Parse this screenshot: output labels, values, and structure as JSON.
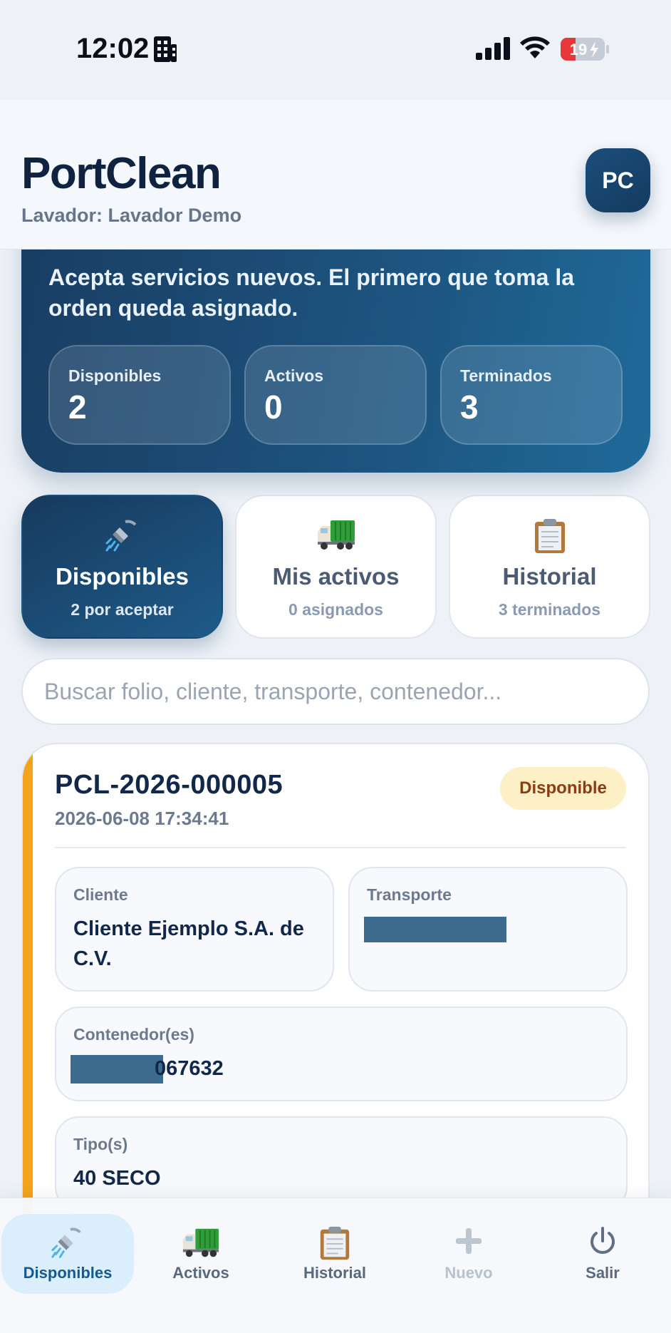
{
  "status_bar": {
    "time": "12:02",
    "battery": "19"
  },
  "header": {
    "app_title": "PortClean",
    "subtitle": "Lavador: Lavador Demo",
    "avatar_initials": "PC"
  },
  "hero": {
    "description": "Acepta servicios nuevos. El primero que toma la orden queda asignado.",
    "stats": [
      {
        "label": "Disponibles",
        "value": "2"
      },
      {
        "label": "Activos",
        "value": "0"
      },
      {
        "label": "Terminados",
        "value": "3"
      }
    ]
  },
  "tabs": [
    {
      "title": "Disponibles",
      "subtitle": "2 por aceptar",
      "icon": "shower-icon",
      "active": true
    },
    {
      "title": "Mis activos",
      "subtitle": "0 asignados",
      "icon": "truck-icon",
      "active": false
    },
    {
      "title": "Historial",
      "subtitle": "3 terminados",
      "icon": "clipboard-icon",
      "active": false
    }
  ],
  "search": {
    "placeholder": "Buscar folio, cliente, transporte, contenedor...",
    "value": ""
  },
  "order": {
    "folio": "PCL-2026-000005",
    "date": "2026-06-08 17:34:41",
    "status": "Disponible",
    "accent_color": "#f5a31a",
    "fields": {
      "cliente_label": "Cliente",
      "cliente_value": "Cliente Ejemplo S.A. de C.V.",
      "transporte_label": "Transporte",
      "contenedor_label": "Contenedor(es)",
      "contenedor_value_visible": "067632",
      "tipo_label": "Tipo(s)",
      "tipo_value": "40 SECO"
    }
  },
  "bottom_nav": [
    {
      "label": "Disponibles",
      "icon": "shower-icon",
      "active": true
    },
    {
      "label": "Activos",
      "icon": "truck-icon",
      "active": false
    },
    {
      "label": "Historial",
      "icon": "clipboard-icon",
      "active": false
    },
    {
      "label": "Nuevo",
      "icon": "plus-icon",
      "active": false,
      "disabled": true
    },
    {
      "label": "Salir",
      "icon": "power-icon",
      "active": false
    }
  ],
  "colors": {
    "primary": "#173a5e",
    "accent": "#f5a31a",
    "badge_bg": "#fdf0c6",
    "badge_text": "#8a3d12"
  }
}
